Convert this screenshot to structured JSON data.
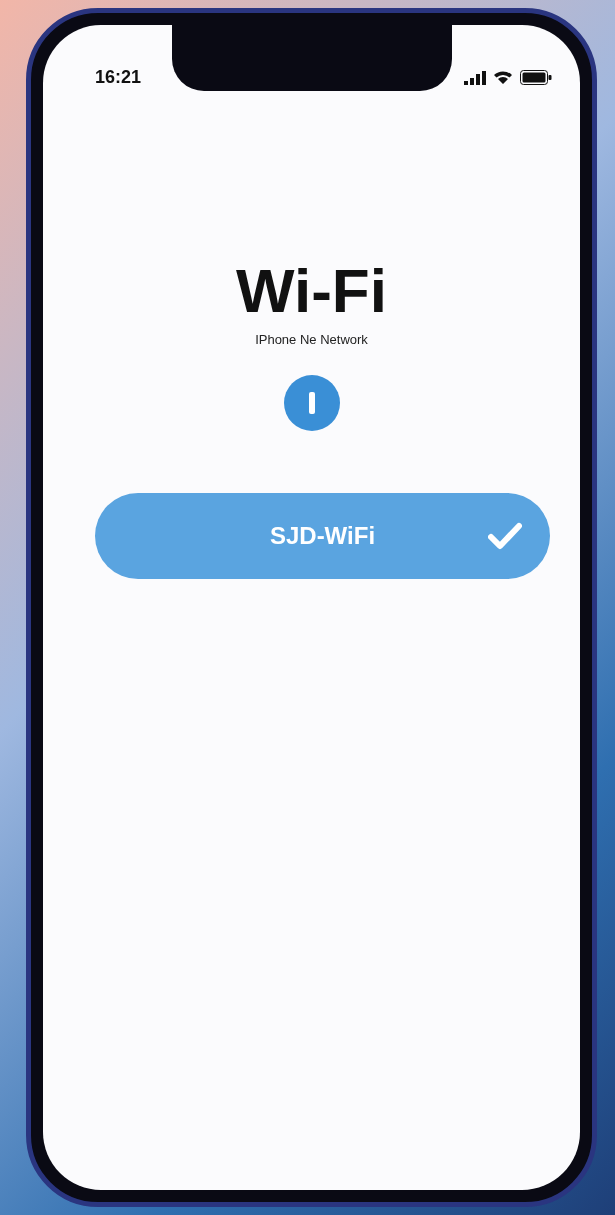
{
  "status_bar": {
    "time": "16:21"
  },
  "header": {
    "title": "Wi-Fi",
    "subtitle": "IPhone Ne Network"
  },
  "networks": [
    {
      "name": "SJD-WiFi",
      "selected": true
    }
  ]
}
